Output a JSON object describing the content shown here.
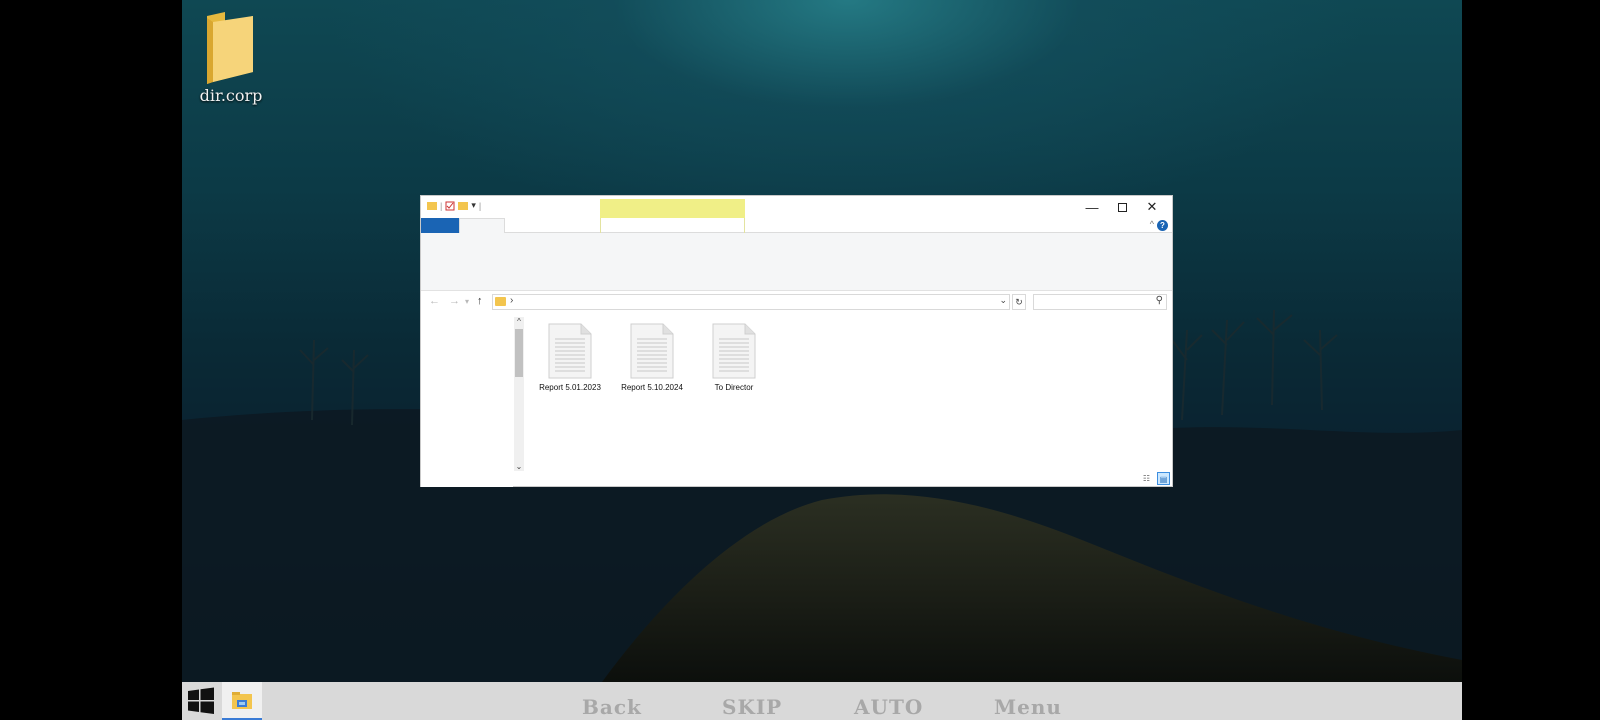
{
  "desktop": {
    "icon_label": "dir.corp"
  },
  "window": {
    "quick_access_sep": "|",
    "address_chevron": "›",
    "files": [
      {
        "name": "Report 5.01.2023"
      },
      {
        "name": "Report 5.10.2024"
      },
      {
        "name": "To Director"
      }
    ],
    "help_glyph": "?"
  },
  "taskbar": {
    "buttons": [
      "Back",
      "SKIP",
      "AUTO",
      "Menu"
    ]
  }
}
